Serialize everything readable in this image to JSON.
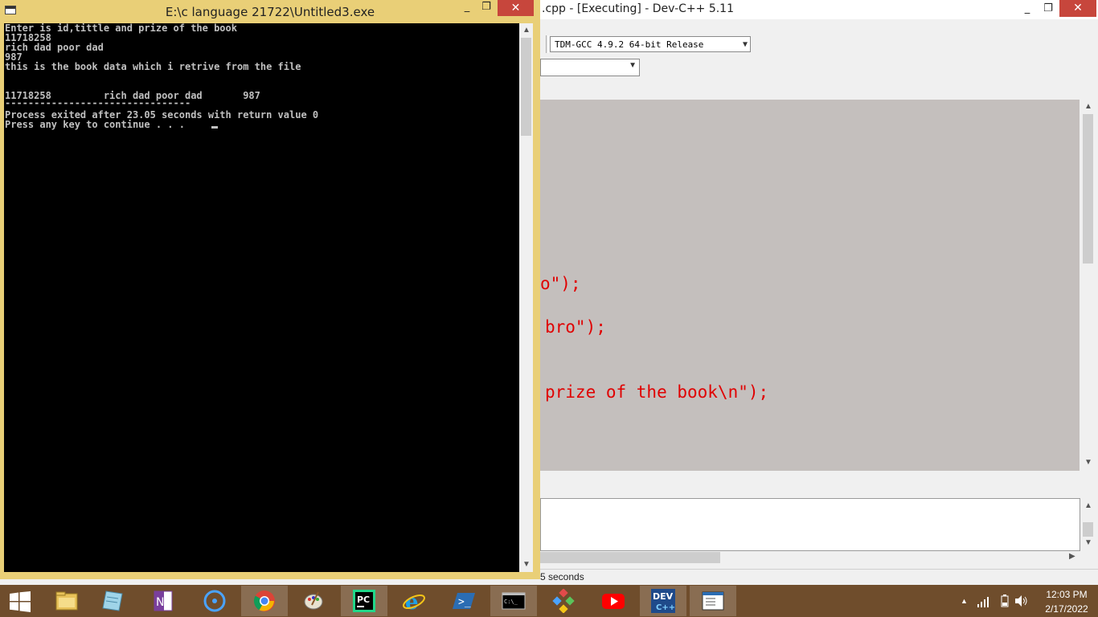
{
  "devcpp": {
    "title": ".cpp - [Executing] - Dev-C++ 5.11",
    "compiler_select": "TDM-GCC 4.9.2 64-bit Release",
    "code_lines": [
      "o\");",
      "bro\");",
      "prize of the book\\n\");"
    ],
    "status_text": "5 seconds",
    "minimize": "_",
    "restore": "❐",
    "close": "✕"
  },
  "console": {
    "title": "E:\\c language 21722\\Untitled3.exe",
    "lines": [
      "Enter is id,tittle and prize of the book",
      "11718258",
      "rich dad poor dad",
      "987",
      "this is the book data which i retrive from the file",
      "",
      "",
      "11718258         rich dad poor dad       987",
      "--------------------------------",
      "Process exited after 23.05 seconds with return value 0",
      "Press any key to continue . . ."
    ],
    "minimize": "_",
    "restore": "❐",
    "close": "✕"
  },
  "taskbar": {
    "time": "12:03 PM",
    "date": "2/17/2022",
    "apps": [
      "start-button",
      "file-explorer",
      "notepad",
      "onenote",
      "cortana",
      "chrome",
      "paint",
      "pycharm",
      "internet-explorer",
      "powershell",
      "command-prompt",
      "other-app",
      "youtube",
      "devcpp",
      "document-viewer"
    ]
  },
  "colors": {
    "console_frame": "#e9cf77",
    "taskbar": "#6f4d2c",
    "code_string": "#e00000",
    "editor_bg": "#c4bfbd"
  }
}
